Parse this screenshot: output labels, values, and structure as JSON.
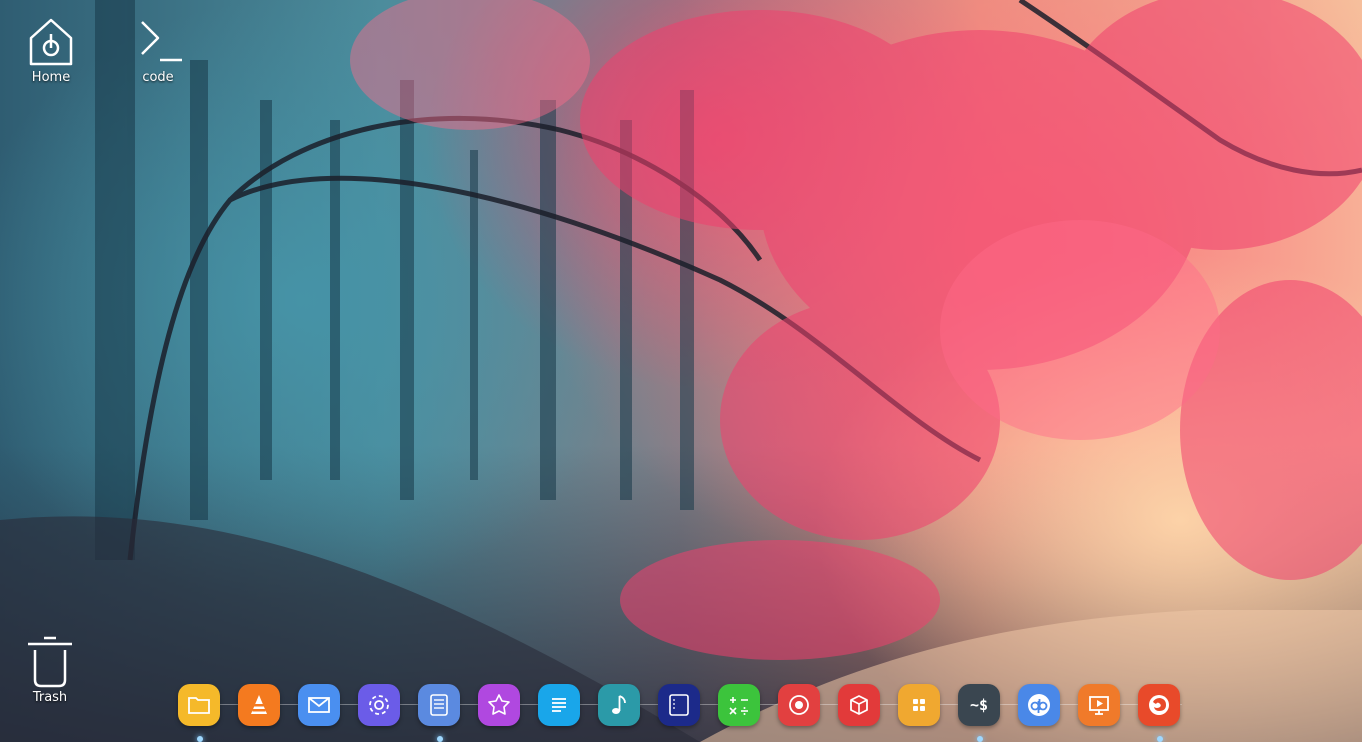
{
  "desktop": {
    "icons": [
      {
        "label": "Home",
        "icon": "home-icon"
      },
      {
        "label": "code",
        "icon": "terminal-icon"
      },
      {
        "label": "Trash",
        "icon": "trash-icon"
      }
    ]
  },
  "dock": {
    "items": [
      {
        "icon": "file-manager-icon",
        "color": "#f5b92a"
      },
      {
        "icon": "vlc-icon",
        "color": "#f47a1f"
      },
      {
        "icon": "mail-icon",
        "color": "#4a8ff0"
      },
      {
        "icon": "settings-icon",
        "color": "#6b5ce8"
      },
      {
        "icon": "document-viewer-icon",
        "color": "#5b8ae0"
      },
      {
        "icon": "launcher-icon",
        "color": "#b048e0"
      },
      {
        "icon": "text-editor-icon",
        "color": "#19a6ea"
      },
      {
        "icon": "music-icon",
        "color": "#2b9aa8"
      },
      {
        "icon": "notes-icon",
        "color": "#1c2a8a"
      },
      {
        "icon": "calculator-icon",
        "color": "#3cc43c"
      },
      {
        "icon": "screenshot-icon",
        "color": "#e24040"
      },
      {
        "icon": "app-store-icon",
        "color": "#e23a3a"
      },
      {
        "icon": "app-grid-icon",
        "color": "#f0a830"
      },
      {
        "icon": "terminal-app-icon",
        "color": "#3a4650",
        "text": "~$"
      },
      {
        "icon": "qbittorrent-icon",
        "color": "#4a88e8"
      },
      {
        "icon": "presentation-icon",
        "color": "#f07a2a"
      },
      {
        "icon": "firefox-icon",
        "color": "#e84a2a"
      }
    ],
    "running_indicator_color": "#9fd8ff"
  }
}
